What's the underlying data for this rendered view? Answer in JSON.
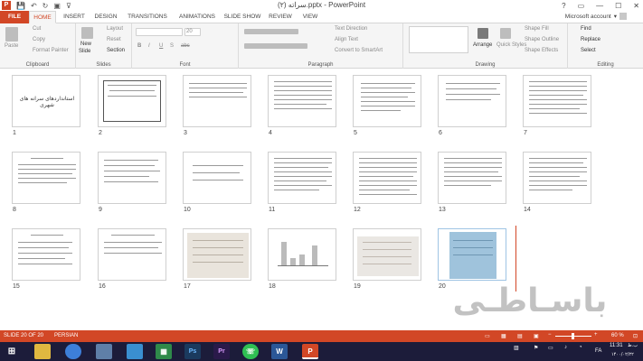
{
  "window": {
    "title": "سراته (۲).pptx - PowerPoint",
    "controls": [
      "?",
      "▭",
      "—",
      "☐",
      "✕"
    ]
  },
  "quick_access": {
    "app_letter": "P",
    "save": "💾",
    "undo": "↶",
    "redo": "↻",
    "present": "▣",
    "more": "⊽"
  },
  "tabs": [
    "FILE",
    "HOME",
    "INSERT",
    "DESIGN",
    "TRANSITIONS",
    "ANIMATIONS",
    "SLIDE SHOW",
    "REVIEW",
    "VIEW"
  ],
  "account": {
    "label": "Microsoft account",
    "arrow": "▾"
  },
  "ribbon": {
    "clipboard": {
      "paste": "Paste",
      "cut": "Cut",
      "copy": "Copy",
      "format_painter": "Format Painter",
      "label": "Clipboard"
    },
    "slides": {
      "new_slide": "New",
      "new_slide2": "Slide",
      "layout": "Layout",
      "reset": "Reset",
      "section": "Section",
      "label": "Slides"
    },
    "font": {
      "size": "20",
      "bold": "B",
      "italic": "I",
      "underline": "U",
      "shadow": "S",
      "strike": "abc",
      "label": "Font"
    },
    "paragraph": {
      "text_direction": "Text Direction",
      "align_text": "Align Text",
      "convert_smartart": "Convert to SmartArt",
      "label": "Paragraph"
    },
    "drawing": {
      "arrange": "Arrange",
      "quick_styles": "Quick Styles",
      "shape_fill": "Shape Fill",
      "shape_outline": "Shape Outline",
      "shape_effects": "Shape Effects",
      "label": "Drawing"
    },
    "editing": {
      "find": "Find",
      "replace": "Replace",
      "select": "Select",
      "label": "Editing"
    }
  },
  "slides": [
    {
      "num": "1",
      "title": "استانداردهای سرانه های شهری"
    },
    {
      "num": "2"
    },
    {
      "num": "3"
    },
    {
      "num": "4"
    },
    {
      "num": "5"
    },
    {
      "num": "6"
    },
    {
      "num": "7"
    },
    {
      "num": "8"
    },
    {
      "num": "9"
    },
    {
      "num": "10"
    },
    {
      "num": "11"
    },
    {
      "num": "12"
    },
    {
      "num": "13"
    },
    {
      "num": "14"
    },
    {
      "num": "15"
    },
    {
      "num": "16"
    },
    {
      "num": "17"
    },
    {
      "num": "18"
    },
    {
      "num": "19"
    },
    {
      "num": "20"
    }
  ],
  "watermark": "باسـاطـی",
  "status": {
    "slide": "SLIDE 20 OF 20",
    "language": "PERSIAN",
    "zoom": "60 %",
    "zoom_percent": 60
  },
  "taskbar": {
    "apps": [
      "explorer",
      "chrome",
      "computer",
      "store",
      "calculator",
      "photoshop",
      "premiere",
      "whatsapp",
      "word",
      "powerpoint"
    ],
    "language": "FA",
    "time": "11:31",
    "day": "ب.ظ",
    "date": "۱۴۰۰/۰۲/۲۲"
  },
  "colors": {
    "accent": "#d24726",
    "taskbar": "#1c1c3a",
    "ribbon_bg": "#f5f5f5"
  }
}
